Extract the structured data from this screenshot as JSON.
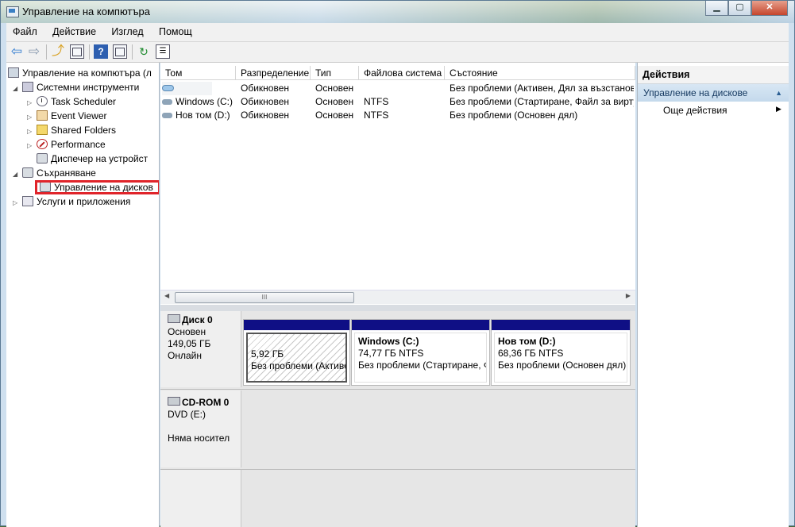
{
  "window": {
    "title": "Управление на компютъра",
    "buttons": [
      "▁",
      "▢",
      "✕"
    ]
  },
  "menu": [
    "Файл",
    "Действие",
    "Изглед",
    "Помощ"
  ],
  "tree": {
    "root": "Управление на компютъра (л",
    "system_tools": "Системни инструменти",
    "task_scheduler": "Task Scheduler",
    "event_viewer": "Event Viewer",
    "shared_folders": "Shared Folders",
    "performance": "Performance",
    "device_manager": "Диспечер на устройст",
    "storage": "Съхраняване",
    "disk_management": "Управление на дисков",
    "services": "Услуги и приложения"
  },
  "volumes": {
    "headers": [
      "Том",
      "Разпределение",
      "Тип",
      "Файлова система",
      "Състояние"
    ],
    "rows": [
      [
        "",
        "Обикновен",
        "Основен",
        "",
        "Без проблеми (Активен, Дял за възстанов"
      ],
      [
        "Windows (C:)",
        "Обикновен",
        "Основен",
        "NTFS",
        "Без проблеми (Стартиране, Файл за вирту"
      ],
      [
        "Нов том (D:)",
        "Обикновен",
        "Основен",
        "NTFS",
        "Без проблеми (Основен дял)"
      ]
    ],
    "scroll_grip": "III"
  },
  "disk0": {
    "name": "Диск 0",
    "type": "Основен",
    "size": "149,05 ГБ",
    "status": "Онлайн",
    "partitions": [
      {
        "name": "",
        "size": "5,92 ГБ",
        "status": "Без проблеми (Активе"
      },
      {
        "name": "Windows  (C:)",
        "size": "74,77 ГБ NTFS",
        "status": "Без проблеми (Стартиране, Ф"
      },
      {
        "name": "Нов том  (D:)",
        "size": "68,36 ГБ NTFS",
        "status": "Без проблеми (Основен дял)"
      }
    ]
  },
  "cdrom0": {
    "name": "CD-ROM 0",
    "drive": "DVD (E:)",
    "status": "Няма носител"
  },
  "actions": {
    "title": "Действия",
    "section": "Управление на дискове",
    "more": "Още действия"
  }
}
